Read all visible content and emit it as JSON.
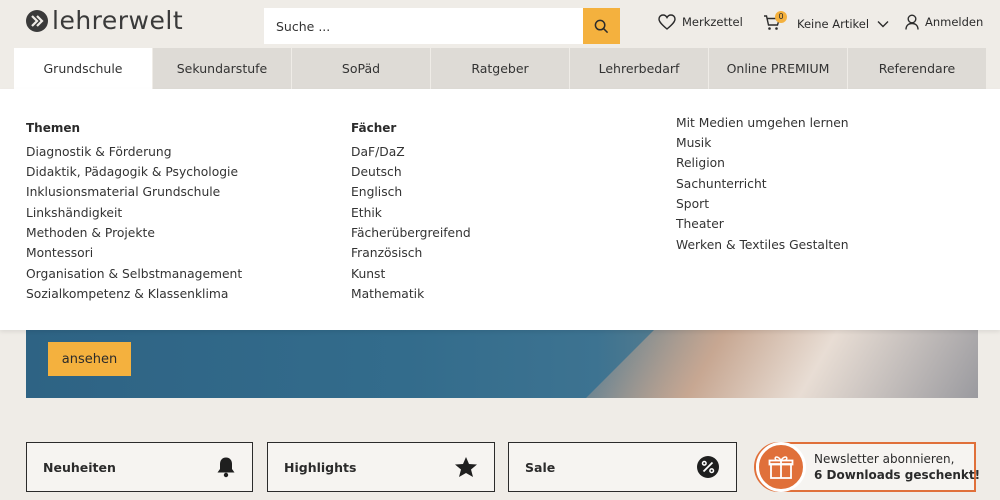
{
  "header": {
    "logo_text": "lehrerwelt",
    "search_placeholder": "Suche ...",
    "merkzettel": "Merkzettel",
    "cart_count": "0",
    "cart_label": "Keine Artikel",
    "login": "Anmelden"
  },
  "nav": {
    "tabs": [
      "Grundschule",
      "Sekundarstufe",
      "SoPäd",
      "Ratgeber",
      "Lehrerbedarf",
      "Online PREMIUM",
      "Referendare"
    ]
  },
  "dropdown": {
    "themen": {
      "title": "Themen",
      "items": [
        "Diagnostik & Förderung",
        "Didaktik, Pädagogik & Psychologie",
        "Inklusionsmaterial Grundschule",
        "Linkshändigkeit",
        "Methoden & Projekte",
        "Montessori",
        "Organisation & Selbstmanagement",
        "Sozialkompetenz & Klassenklima"
      ]
    },
    "faecher": {
      "title": "Fächer",
      "items": [
        "DaF/DaZ",
        "Deutsch",
        "Englisch",
        "Ethik",
        "Fächerübergreifend",
        "Französisch",
        "Kunst",
        "Mathematik"
      ]
    },
    "faecher2": {
      "items": [
        "Mit Medien umgehen lernen",
        "Musik",
        "Religion",
        "Sachunterricht",
        "Sport",
        "Theater",
        "Werken & Textiles Gestalten"
      ]
    }
  },
  "hero": {
    "button": "ansehen"
  },
  "tiles": {
    "neuheiten": "Neuheiten",
    "highlights": "Highlights",
    "sale": "Sale"
  },
  "newsletter": {
    "line1": "Newsletter abonnieren,",
    "line2": "6 Downloads geschenkt!"
  },
  "colors": {
    "accent": "#f4b13e",
    "newsletter": "#e0703a",
    "nav_bg": "#dedbd6"
  }
}
